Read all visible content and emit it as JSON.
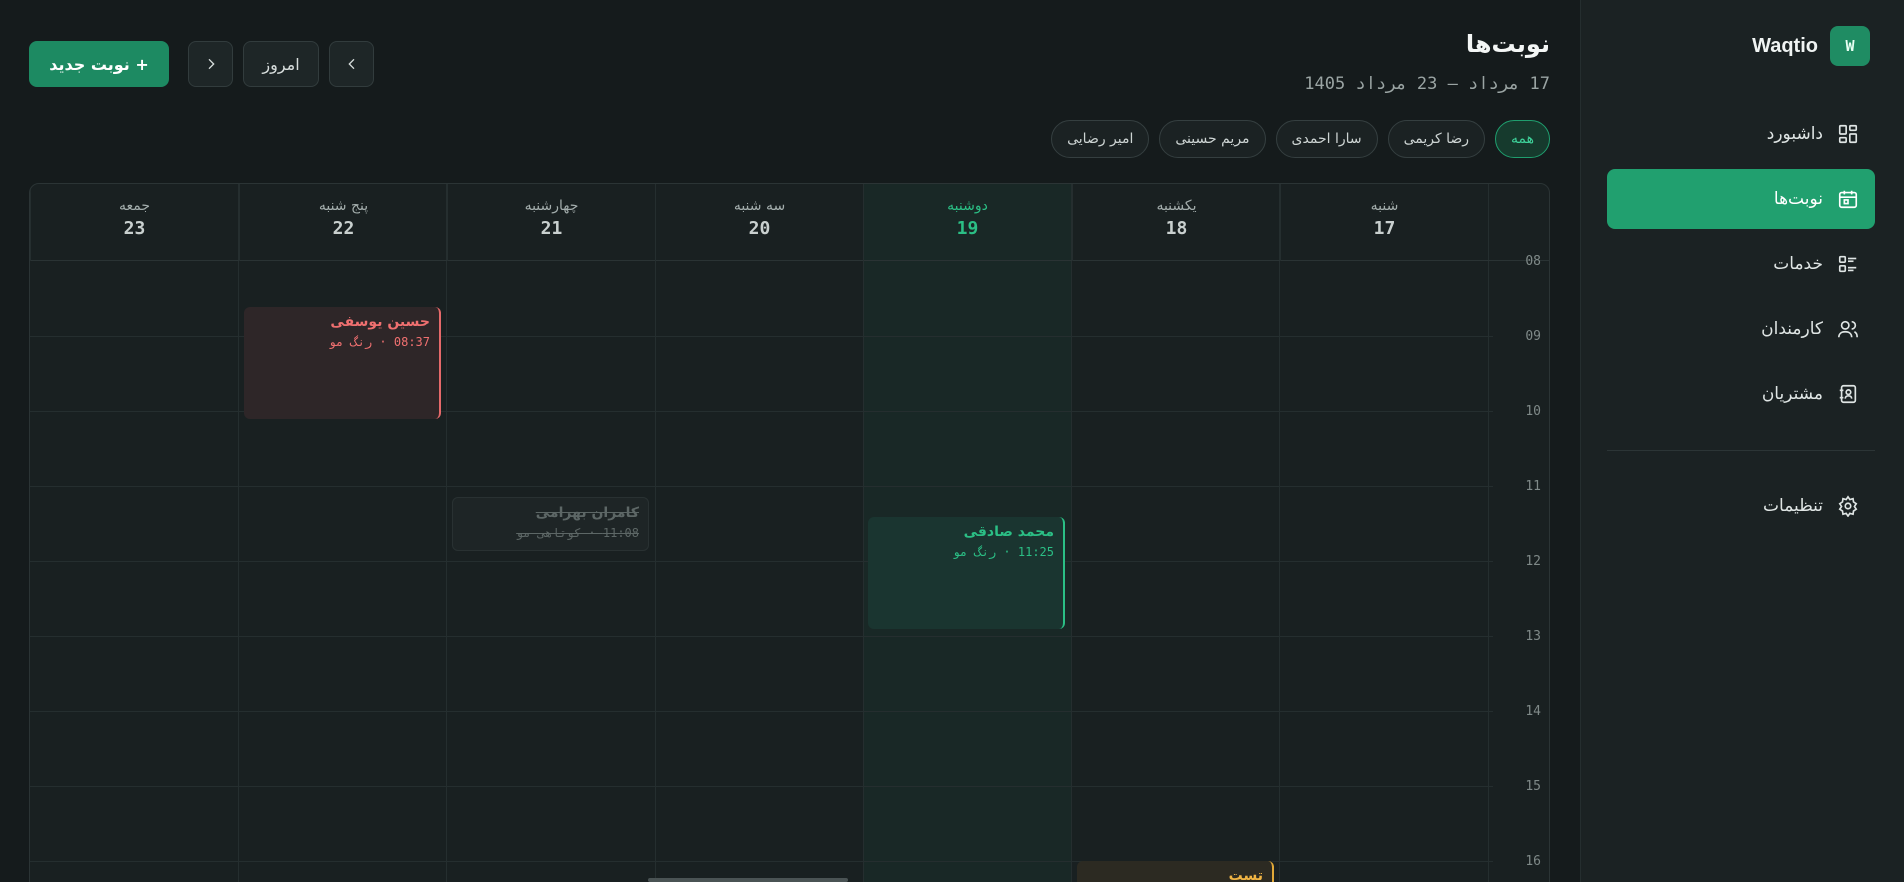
{
  "brand": {
    "name": "Waqtio",
    "logo_letter": "W"
  },
  "nav": [
    {
      "label": "داشبورد",
      "icon": "dashboard-icon",
      "active": false
    },
    {
      "label": "نوبت‌ها",
      "icon": "calendar-icon",
      "active": true
    },
    {
      "label": "خدمات",
      "icon": "services-list-icon",
      "active": false
    },
    {
      "label": "کارمندان",
      "icon": "staff-users-icon",
      "active": false
    },
    {
      "label": "مشتریان",
      "icon": "contacts-book-icon",
      "active": false
    }
  ],
  "settings": {
    "label": "تنظیمات",
    "icon": "gear-icon"
  },
  "header": {
    "title": "نوبت‌ها",
    "date_range": "17 مرداد — 23 مرداد 1405"
  },
  "toolbar": {
    "new_label": "+ نوبت جدید",
    "today_label": "امروز"
  },
  "filters": [
    "همه",
    "رضا کریمی",
    "سارا احمدی",
    "مریم حسینی",
    "امیر رضایی"
  ],
  "days": [
    {
      "name": "شنبه",
      "num": "17"
    },
    {
      "name": "یکشنبه",
      "num": "18"
    },
    {
      "name": "دوشنبه",
      "num": "19"
    },
    {
      "name": "سه شنبه",
      "num": "20"
    },
    {
      "name": "چهارشنبه",
      "num": "21"
    },
    {
      "name": "پنج شنبه",
      "num": "22"
    },
    {
      "name": "جمعه",
      "num": "23"
    }
  ],
  "hours": [
    "08",
    "09",
    "10",
    "11",
    "12",
    "13",
    "14",
    "15",
    "16"
  ],
  "appointments": [
    {
      "customer": "حسین یوسفی",
      "meta": "08:37 · رنگ مو"
    },
    {
      "customer": "کامران بهرامی",
      "meta": "11:08 · کوتاهی مو"
    },
    {
      "customer": "محمد صادقی",
      "meta": "11:25 · رنگ مو"
    },
    {
      "customer": "تست",
      "meta": ""
    }
  ],
  "colors": {
    "accent": "#21a06f",
    "red": "#f07070",
    "amber": "#f0b444"
  }
}
